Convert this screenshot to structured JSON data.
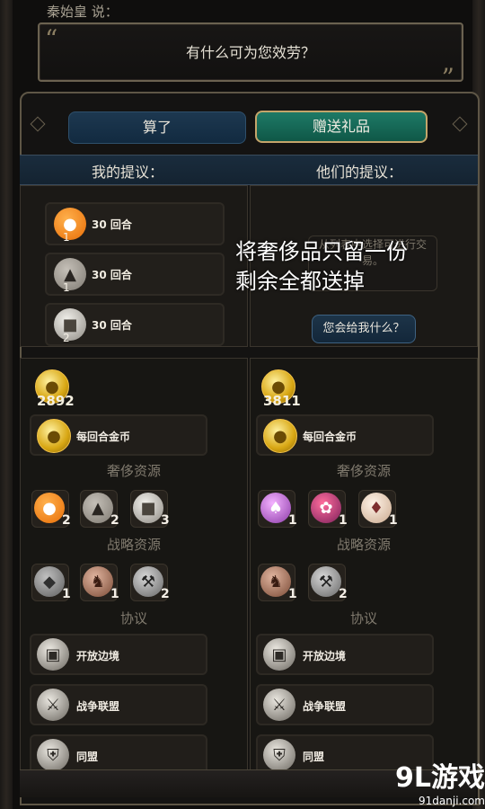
{
  "dialogue": {
    "speaker": "秦始皇 说：",
    "text": "有什么可为您效劳？"
  },
  "actions": {
    "cancel": "算了",
    "gift": "赠送礼品"
  },
  "headers": {
    "mine": "我的提议：",
    "theirs": "他们的提议："
  },
  "offers": {
    "left": [
      {
        "label": "30 回合",
        "count": "1",
        "icon": "orange-icon"
      },
      {
        "label": "30 回合",
        "count": "1",
        "icon": "elephant-icon"
      },
      {
        "label": "30 回合",
        "count": "2",
        "icon": "salt-icon"
      }
    ],
    "right_hint": "从列表中选择可进行交易。",
    "ask_button": "您会给我什么？"
  },
  "overlay": {
    "line1": "将奢侈品只留一份",
    "line2": "剩余全都送掉"
  },
  "inventory": {
    "left": {
      "gold": "2892",
      "gold_per_turn": "每回合金币",
      "luxury_title": "奢侈资源",
      "luxury_items": [
        {
          "icon": "orange-icon",
          "count": "2"
        },
        {
          "icon": "elephant-icon",
          "count": "2"
        },
        {
          "icon": "salt-icon",
          "count": "3"
        }
      ],
      "strategic_title": "战略资源",
      "strategic_items": [
        {
          "icon": "stone-icon",
          "count": "1"
        },
        {
          "icon": "horse-icon",
          "count": "1"
        },
        {
          "icon": "iron-icon",
          "count": "2"
        }
      ],
      "agreement_title": "协议",
      "agreements": [
        {
          "label": "开放边境",
          "icon": "border-icon"
        },
        {
          "label": "战争联盟",
          "icon": "war-icon"
        },
        {
          "label": "同盟",
          "icon": "ally-icon"
        }
      ]
    },
    "right": {
      "gold": "3811",
      "gold_per_turn": "每回合金币",
      "luxury_title": "奢侈资源",
      "luxury_items": [
        {
          "icon": "perfume-icon",
          "count": "1"
        },
        {
          "icon": "silk-icon",
          "count": "1"
        },
        {
          "icon": "cloth-icon",
          "count": "1"
        }
      ],
      "strategic_title": "战略资源",
      "strategic_items": [
        {
          "icon": "horse-icon",
          "count": "1"
        },
        {
          "icon": "iron-icon",
          "count": "2"
        }
      ],
      "agreement_title": "协议",
      "agreements": [
        {
          "label": "开放边境",
          "icon": "border-icon"
        },
        {
          "label": "战争联盟",
          "icon": "war-icon"
        },
        {
          "label": "同盟",
          "icon": "ally-icon"
        }
      ]
    }
  },
  "watermark": {
    "brand": "9L游戏",
    "site": "91danji.com"
  }
}
